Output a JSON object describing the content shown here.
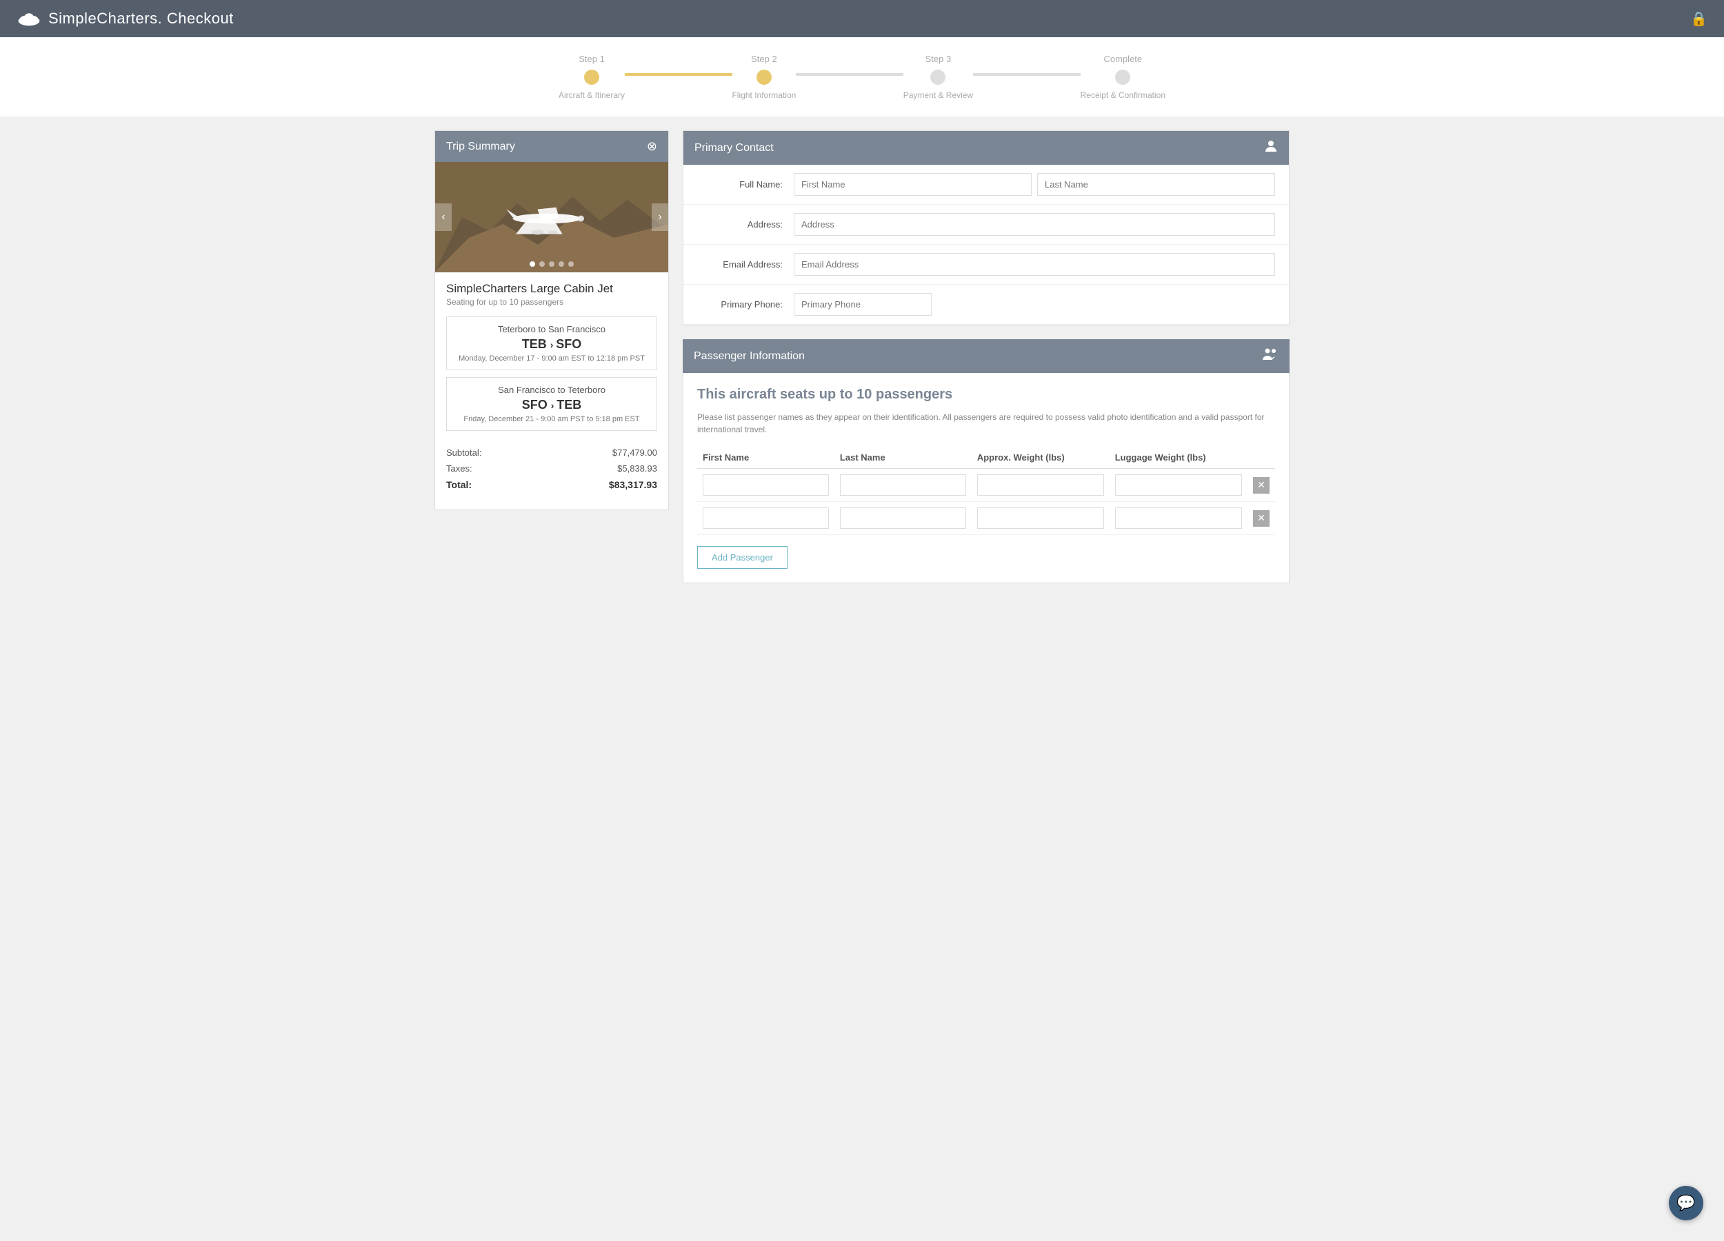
{
  "header": {
    "logo_text": "SimpleCharters.",
    "title": "Checkout",
    "lock_icon": "🔒"
  },
  "progress": {
    "steps": [
      {
        "label": "Step 1",
        "sublabel": "Aircraft & Itinerary",
        "state": "completed"
      },
      {
        "label": "Step 2",
        "sublabel": "Flight Information",
        "state": "active"
      },
      {
        "label": "Step 3",
        "sublabel": "Payment & Review",
        "state": "inactive"
      },
      {
        "label": "Complete",
        "sublabel": "Receipt & Confirmation",
        "state": "inactive"
      }
    ]
  },
  "trip_summary": {
    "panel_title": "Trip Summary",
    "aircraft_name": "SimpleCharters Large Cabin Jet",
    "aircraft_seats": "Seating for up to 10 passengers",
    "carousel_dots": [
      true,
      false,
      false,
      false,
      false
    ],
    "routes": [
      {
        "cities": "Teterboro to San Francisco",
        "codes_from": "TEB",
        "codes_to": "SFO",
        "date": "Monday, December 17 - 9:00 am EST to 12:18 pm PST"
      },
      {
        "cities": "San Francisco to Teterboro",
        "codes_from": "SFO",
        "codes_to": "TEB",
        "date": "Friday, December 21 - 9:00 am PST to 5:18 pm EST"
      }
    ],
    "subtotal_label": "Subtotal:",
    "subtotal_value": "$77,479.00",
    "taxes_label": "Taxes:",
    "taxes_value": "$5,838.93",
    "total_label": "Total:",
    "total_value": "$83,317.93"
  },
  "primary_contact": {
    "panel_title": "Primary Contact",
    "fields": [
      {
        "label": "Full Name:",
        "placeholders": [
          "First Name",
          "Last Name"
        ],
        "type": "name"
      },
      {
        "label": "Address:",
        "placeholders": [
          "Address"
        ],
        "type": "single"
      },
      {
        "label": "Email Address:",
        "placeholders": [
          "Email Address"
        ],
        "type": "single"
      },
      {
        "label": "Primary Phone:",
        "placeholders": [
          "Primary Phone"
        ],
        "type": "single"
      }
    ]
  },
  "passenger_info": {
    "panel_title": "Passenger Information",
    "section_title": "This aircraft seats up to 10 passengers",
    "description": "Please list passenger names as they appear on their identification. All passengers are required to possess valid photo identification and a valid passport for international travel.",
    "table_headers": [
      "First Name",
      "Last Name",
      "Approx. Weight (lbs)",
      "Luggage Weight (lbs)"
    ],
    "rows": [
      {
        "id": 1
      },
      {
        "id": 2
      }
    ],
    "add_button_label": "Add Passenger"
  },
  "chat": {
    "icon": "💬"
  }
}
